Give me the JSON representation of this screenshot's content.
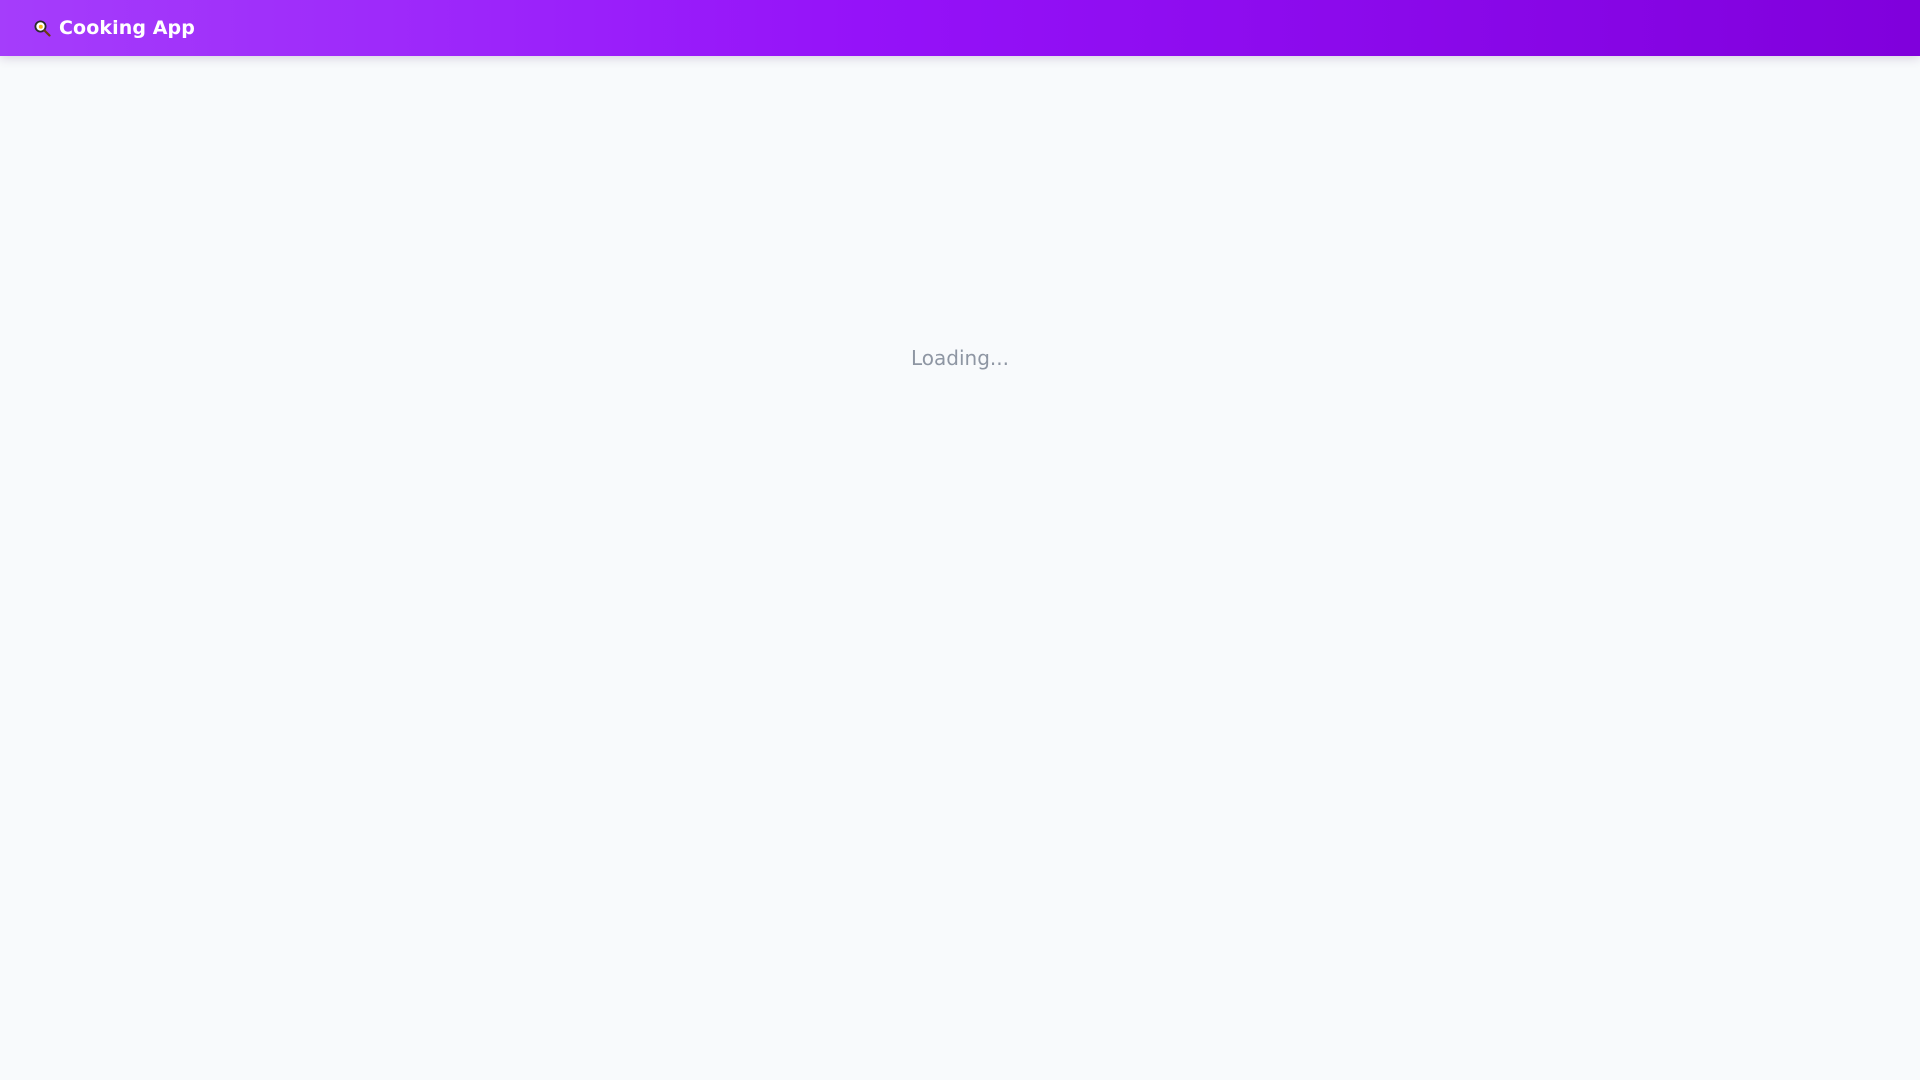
{
  "header": {
    "title": "Cooking App",
    "icon": "frying-pan-icon"
  },
  "main": {
    "status_text": "Loading..."
  },
  "colors": {
    "header_gradient_start": "#a53dfb",
    "header_gradient_end": "#8000dc",
    "background": "#f8fafc",
    "loading_text": "#8e96a3"
  }
}
